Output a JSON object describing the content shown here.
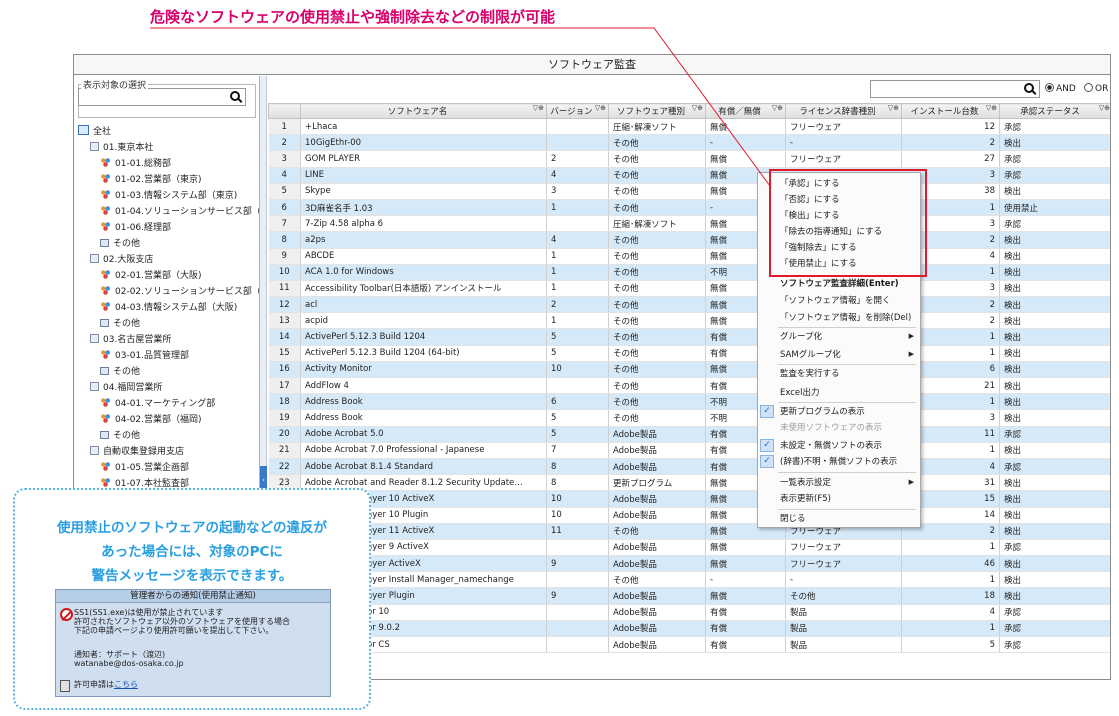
{
  "headline": "危険なソフトウェアの使用禁止や強制除去などの制限が可能",
  "window": {
    "title": "ソフトウェア監査"
  },
  "left_panel": {
    "legend": "表示対象の選択",
    "search_value": "",
    "tree": [
      {
        "label": "全社",
        "icon": "org-root-icon",
        "level": 0
      },
      {
        "label": "01.東京本社",
        "icon": "branch-icon",
        "level": 1
      },
      {
        "label": "01-01.総務部",
        "icon": "department-icon",
        "level": 2
      },
      {
        "label": "01-02.営業部（東京)",
        "icon": "department-icon",
        "level": 2
      },
      {
        "label": "01-03.情報システム部（東京)",
        "icon": "department-icon",
        "level": 2
      },
      {
        "label": "01-04.ソリューションサービス部（",
        "icon": "department-icon",
        "level": 2
      },
      {
        "label": "01-06.経理部",
        "icon": "department-icon",
        "level": 2
      },
      {
        "label": "その他",
        "icon": "other-icon",
        "level": 2
      },
      {
        "label": "02.大阪支店",
        "icon": "branch-icon",
        "level": 1
      },
      {
        "label": "02-01.営業部（大阪)",
        "icon": "department-icon",
        "level": 2
      },
      {
        "label": "02-02.ソリューションサービス部（",
        "icon": "department-icon",
        "level": 2
      },
      {
        "label": "04-03.情報システム部（大阪)",
        "icon": "department-icon",
        "level": 2
      },
      {
        "label": "その他",
        "icon": "other-icon",
        "level": 2
      },
      {
        "label": "03.名古屋営業所",
        "icon": "branch-icon",
        "level": 1
      },
      {
        "label": "03-01.品質管理部",
        "icon": "department-icon",
        "level": 2
      },
      {
        "label": "その他",
        "icon": "other-icon",
        "level": 2
      },
      {
        "label": "04.福岡営業所",
        "icon": "branch-icon",
        "level": 1
      },
      {
        "label": "04-01.マーケティング部",
        "icon": "department-icon",
        "level": 2
      },
      {
        "label": "04-02.営業部（福岡)",
        "icon": "department-icon",
        "level": 2
      },
      {
        "label": "その他",
        "icon": "other-icon",
        "level": 2
      },
      {
        "label": "自動収集登録用支店",
        "icon": "branch-icon",
        "level": 1
      },
      {
        "label": "01-05.営業企画部",
        "icon": "department-icon",
        "level": 2
      },
      {
        "label": "01-07.本社監査部",
        "icon": "department-icon",
        "level": 2
      }
    ]
  },
  "search": {
    "value": "",
    "and_label": "AND",
    "or_label": "OR",
    "selected": "AND"
  },
  "table": {
    "columns": [
      "",
      "ソフトウェア名",
      "バージョン",
      "ソフトウェア種別",
      "有償／無償",
      "ライセンス辞書種別",
      "インストール台数",
      "承認ステータス"
    ],
    "filter_glyph": "▽⊕",
    "rows": [
      [
        "1",
        "+Lhaca",
        "",
        "圧縮･解凍ソフト",
        "無償",
        "フリーウェア",
        "12",
        "承認"
      ],
      [
        "2",
        "10GigEthr-00",
        "",
        "その他",
        "-",
        "-",
        "2",
        "検出"
      ],
      [
        "3",
        "GOM PLAYER",
        "2",
        "その他",
        "無償",
        "フリーウェア",
        "27",
        "承認"
      ],
      [
        "4",
        "LINE",
        "4",
        "その他",
        "無償",
        "",
        "3",
        "承認"
      ],
      [
        "5",
        "Skype",
        "3",
        "その他",
        "無償",
        "",
        "38",
        "検出"
      ],
      [
        "6",
        "3D麻雀名手 1.03",
        "1",
        "その他",
        "-",
        "",
        "1",
        "使用禁止"
      ],
      [
        "7",
        "7-Zip 4.58 alpha 6",
        "",
        "圧縮･解凍ソフト",
        "無償",
        "",
        "3",
        "承認"
      ],
      [
        "8",
        "a2ps",
        "4",
        "その他",
        "無償",
        "",
        "2",
        "検出"
      ],
      [
        "9",
        "ABCDE",
        "1",
        "その他",
        "無償",
        "",
        "4",
        "検出"
      ],
      [
        "10",
        "ACA 1.0 for Windows",
        "1",
        "その他",
        "不明",
        "",
        "1",
        "検出"
      ],
      [
        "11",
        "Accessibility Toolbar(日本語版) アンインストール",
        "1",
        "その他",
        "無償",
        "",
        "3",
        "検出"
      ],
      [
        "12",
        "acl",
        "2",
        "その他",
        "無償",
        "",
        "2",
        "検出"
      ],
      [
        "13",
        "acpid",
        "1",
        "その他",
        "無償",
        "",
        "2",
        "検出"
      ],
      [
        "14",
        "ActivePerl 5.12.3 Build 1204",
        "5",
        "その他",
        "有償",
        "",
        "1",
        "検出"
      ],
      [
        "15",
        "ActivePerl 5.12.3 Build 1204 (64-bit)",
        "5",
        "その他",
        "有償",
        "",
        "1",
        "検出"
      ],
      [
        "16",
        "Activity Monitor",
        "10",
        "その他",
        "無償",
        "",
        "6",
        "検出"
      ],
      [
        "17",
        "AddFlow 4",
        "",
        "その他",
        "有償",
        "",
        "21",
        "検出"
      ],
      [
        "18",
        "Address Book",
        "6",
        "その他",
        "不明",
        "",
        "1",
        "検出"
      ],
      [
        "19",
        "Address Book",
        "5",
        "その他",
        "不明",
        "",
        "3",
        "検出"
      ],
      [
        "20",
        "Adobe Acrobat 5.0",
        "5",
        "Adobe製品",
        "有償",
        "",
        "11",
        "承認"
      ],
      [
        "21",
        "Adobe Acrobat 7.0 Professional - Japanese",
        "7",
        "Adobe製品",
        "有償",
        "",
        "1",
        "検出"
      ],
      [
        "22",
        "Adobe Acrobat 8.1.4 Standard",
        "8",
        "Adobe製品",
        "有償",
        "",
        "4",
        "承認"
      ],
      [
        "23",
        "Adobe Acrobat and Reader 8.1.2 Security Update…",
        "8",
        "更新プログラム",
        "無償",
        "",
        "31",
        "検出"
      ],
      [
        "24",
        "Adobe Flash Player 10 ActiveX",
        "10",
        "Adobe製品",
        "無償",
        "",
        "15",
        "検出"
      ],
      [
        "25",
        "Adobe Flash Player 10 Plugin",
        "10",
        "Adobe製品",
        "無償",
        "",
        "14",
        "検出"
      ],
      [
        "26",
        "Adobe Flash Player 11 ActiveX",
        "11",
        "その他",
        "無償",
        "フリーウェア",
        "2",
        "検出"
      ],
      [
        "27",
        "Adobe Flash Player 9 ActiveX",
        "",
        "Adobe製品",
        "無償",
        "フリーウェア",
        "1",
        "承認"
      ],
      [
        "28",
        "Adobe Flash Player ActiveX",
        "9",
        "Adobe製品",
        "無償",
        "フリーウェア",
        "46",
        "検出"
      ],
      [
        "29",
        "Adobe Flash Player Install Manager_namechange",
        "",
        "その他",
        "-",
        "-",
        "1",
        "検出"
      ],
      [
        "30",
        "Adobe Flash Player Plugin",
        "9",
        "Adobe製品",
        "無償",
        "その他",
        "18",
        "検出"
      ],
      [
        "31",
        "Adobe Illustrator 10",
        "",
        "Adobe製品",
        "有償",
        "製品",
        "4",
        "承認"
      ],
      [
        "32",
        "Adobe Illustrator 9.0.2",
        "",
        "Adobe製品",
        "有償",
        "製品",
        "1",
        "承認"
      ],
      [
        "33",
        "Adobe Illustrator CS",
        "",
        "Adobe製品",
        "有償",
        "製品",
        "5",
        "承認"
      ]
    ]
  },
  "context_menu": {
    "items": [
      {
        "label": "「承認」にする",
        "type": "item"
      },
      {
        "label": "「否認」にする",
        "type": "item"
      },
      {
        "label": "「検出」にする",
        "type": "item"
      },
      {
        "label": "「除去の指導通知」にする",
        "type": "item"
      },
      {
        "label": "「強制除去」にする",
        "type": "item"
      },
      {
        "label": "「使用禁止」にする",
        "type": "item"
      },
      {
        "label": "ソフトウェア監査詳細(Enter)",
        "type": "item",
        "bold": true
      },
      {
        "label": "「ソフトウェア情報」を開く",
        "type": "item"
      },
      {
        "label": "「ソフトウェア情報」を削除(Del)",
        "type": "item"
      },
      {
        "label": "グループ化",
        "type": "submenu"
      },
      {
        "label": "SAMグループ化",
        "type": "submenu"
      },
      {
        "label": "監査を実行する",
        "type": "item"
      },
      {
        "label": "Excel出力",
        "type": "item"
      },
      {
        "label": "更新プログラムの表示",
        "type": "check",
        "checked": true
      },
      {
        "label": "未使用ソフトウェアの表示",
        "type": "check",
        "disabled": true
      },
      {
        "label": "未設定・無償ソフトの表示",
        "type": "check",
        "checked": true
      },
      {
        "label": "(辞書)不明・無償ソフトの表示",
        "type": "check",
        "checked": true
      },
      {
        "label": "一覧表示設定",
        "type": "submenu"
      },
      {
        "label": "表示更新(F5)",
        "type": "item"
      },
      {
        "label": "閉じる",
        "type": "item"
      }
    ]
  },
  "callout": {
    "lines": [
      "使用禁止のソフトウェアの起動などの違反が",
      "あった場合には、対象のPCに",
      "警告メッセージを表示できます。"
    ],
    "notice": {
      "title": "管理者からの通知(使用禁止通知)",
      "body": [
        "SS1(SS1.exe)は使用が禁止されています",
        "許可されたソフトウェア以外のソフトウェアを使用する場合",
        "下記の申請ページより使用許可願いを提出して下さい。"
      ],
      "notifier": "通知者：サポート（渡辺)",
      "email": "watanabe@dos-osaka.co.jp",
      "link_prefix": "許可申請は",
      "link_text": "こちら"
    }
  },
  "colors": {
    "headline": "#d9006c",
    "callout": "#2a9fe0",
    "highlight": "#e0192b",
    "row_alt": "#d6e9f8"
  }
}
